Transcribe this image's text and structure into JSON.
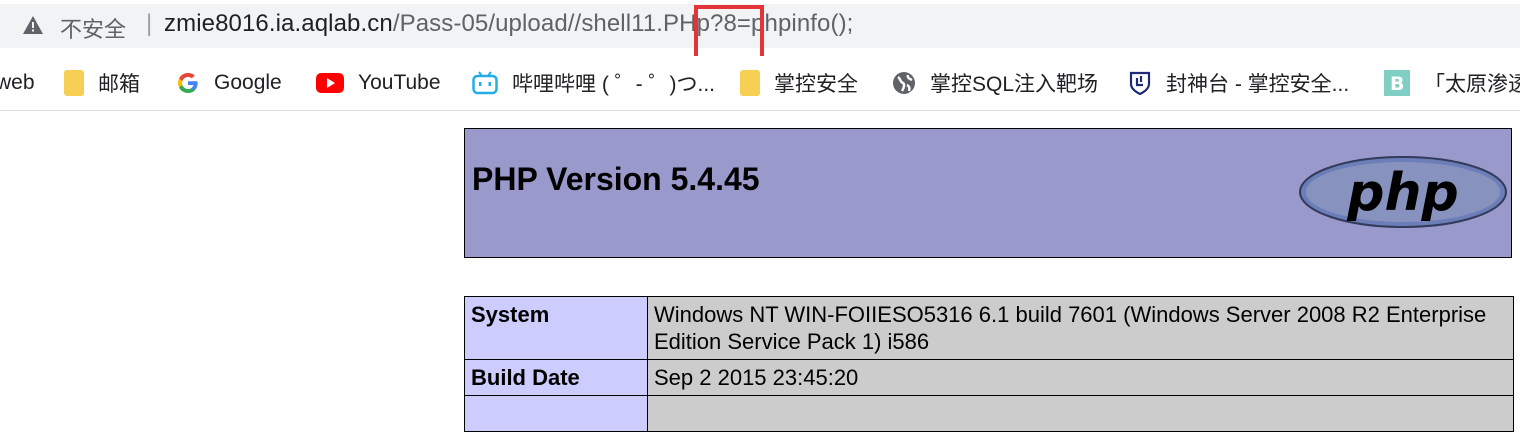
{
  "address_bar": {
    "security_label": "不安全",
    "separator": "|",
    "url_host": "zmie8016.ia.aqlab.cn",
    "url_path": "/Pass-05/upload//shell11.PHp?8=phpinfo();"
  },
  "bookmarks": [
    {
      "label": "web",
      "icon": "folder-icon"
    },
    {
      "label": "邮箱",
      "icon": "folder-icon"
    },
    {
      "label": "Google",
      "icon": "google-icon"
    },
    {
      "label": "YouTube",
      "icon": "youtube-icon"
    },
    {
      "label": "哔哩哔哩 ( ゜- ゜)つ...",
      "icon": "bilibili-icon"
    },
    {
      "label": "掌控安全",
      "icon": "folder-icon"
    },
    {
      "label": "掌控SQL注入靶场",
      "icon": "globe-icon"
    },
    {
      "label": "封神台 - 掌控安全...",
      "icon": "shield-icon"
    },
    {
      "label": "「太原渗透",
      "icon": "b-icon"
    }
  ],
  "phpinfo": {
    "title": "PHP Version 5.4.45",
    "logo_text": "php",
    "rows": [
      {
        "key": "System",
        "value": "Windows NT WIN-FOIIESO5316 6.1 build 7601 (Windows Server 2008 R2 Enterprise Edition Service Pack 1) i586"
      },
      {
        "key": "Build Date",
        "value": "Sep 2 2015 23:45:20"
      }
    ]
  },
  "colors": {
    "header_bg": "#9999cc",
    "key_cell_bg": "#ccccff",
    "value_cell_bg": "#cccccc",
    "highlight_box": "#e3343a"
  }
}
